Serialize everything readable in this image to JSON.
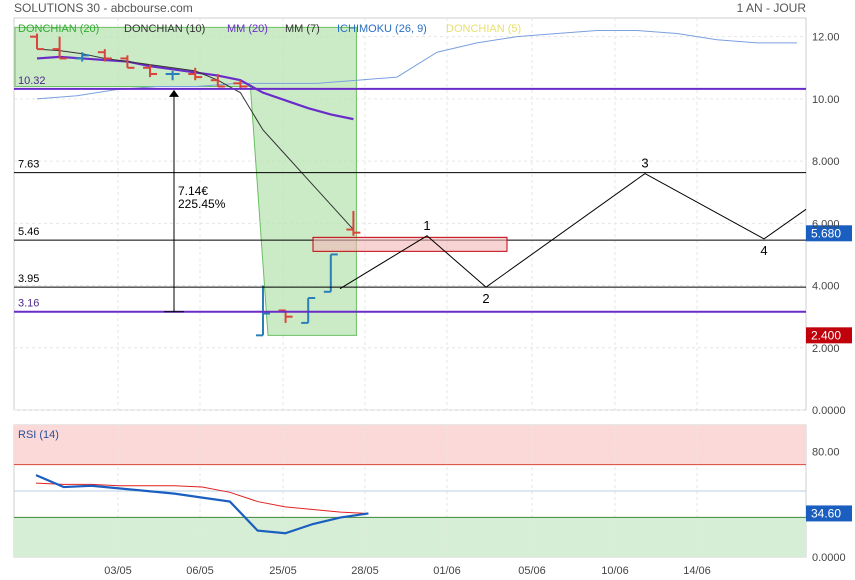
{
  "header": {
    "title": "SOLUTIONS 30 - abcbourse.com",
    "period": "1 AN - JOUR"
  },
  "legend": [
    {
      "label": "DONCHIAN (20)",
      "color": "#33aa33"
    },
    {
      "label": "DONCHIAN (10)",
      "color": "#333333"
    },
    {
      "label": "MM (20)",
      "color": "#6a2cc9"
    },
    {
      "label": "MM (7)",
      "color": "#333333"
    },
    {
      "label": "ICHIMOKU (26, 9)",
      "color": "#2a6fc4"
    },
    {
      "label": "DONCHIAN (5)",
      "color": "#e8e070"
    }
  ],
  "colors": {
    "up_candle": "#2a7fb8",
    "down_candle": "#d9453b",
    "donchian_fill": "#b9e4b4",
    "mm20": "#6a2cc9",
    "rsi_line": "#1a5fc0",
    "rsi_signal": "#e02020",
    "price_badge": "#1a5fc0",
    "low_badge": "#c0000b",
    "rsi_badge": "#1a5fc0"
  },
  "chart_data": [
    {
      "type": "line",
      "title": "SOLUTIONS 30",
      "ylim": [
        0,
        12.6
      ],
      "y_ticks": [
        "12.00",
        "10.00",
        "8.000",
        "6.000",
        "4.000",
        "2.000",
        "0.0000"
      ],
      "y_tick_values": [
        12,
        10,
        8,
        6,
        4,
        2,
        0
      ],
      "x_ticks": [
        "03/05",
        "06/05",
        "25/05",
        "28/05",
        "01/06",
        "05/06",
        "10/06",
        "14/06"
      ],
      "candles": [
        {
          "open": 12.0,
          "high": 12.1,
          "low": 11.6,
          "close": 11.6
        },
        {
          "open": 11.6,
          "high": 12.0,
          "low": 11.3,
          "close": 11.3
        },
        {
          "open": 11.3,
          "high": 11.5,
          "low": 11.2,
          "close": 11.4
        },
        {
          "open": 11.5,
          "high": 11.6,
          "low": 11.2,
          "close": 11.3
        },
        {
          "open": 11.3,
          "high": 11.4,
          "low": 11.0,
          "close": 11.0
        },
        {
          "open": 11.0,
          "high": 11.1,
          "low": 10.7,
          "close": 10.8
        },
        {
          "open": 10.8,
          "high": 10.9,
          "low": 10.6,
          "close": 10.8
        },
        {
          "open": 10.8,
          "high": 11.0,
          "low": 10.6,
          "close": 10.7
        },
        {
          "open": 10.6,
          "high": 10.8,
          "low": 10.4,
          "close": 10.4
        },
        {
          "open": 10.5,
          "high": 10.6,
          "low": 10.3,
          "close": 10.4
        },
        {
          "open": 2.4,
          "high": 4.0,
          "low": 2.4,
          "close": 3.1
        },
        {
          "open": 3.2,
          "high": 3.2,
          "low": 2.8,
          "close": 3.0
        },
        {
          "open": 2.8,
          "high": 3.6,
          "low": 2.8,
          "close": 3.6
        },
        {
          "open": 3.8,
          "high": 5.0,
          "low": 3.8,
          "close": 5.0
        },
        {
          "open": 5.8,
          "high": 6.4,
          "low": 5.6,
          "close": 5.7
        }
      ],
      "series": [
        {
          "name": "DONCHIAN (20)",
          "upper": 12.3,
          "lower_start": 10.4,
          "lower_end": 2.4
        },
        {
          "name": "MM (20)",
          "values": [
            11.3,
            11.35,
            11.3,
            11.25,
            11.2,
            11.05,
            10.95,
            10.85,
            10.75,
            10.6,
            10.2,
            9.95,
            9.7,
            9.5,
            9.35
          ]
        },
        {
          "name": "MM (7)",
          "values": [
            11.6,
            11.55,
            11.45,
            11.3,
            11.2,
            11.1,
            11.0,
            10.9,
            10.6,
            10.2,
            9.0,
            8.2,
            7.4,
            6.6,
            5.8
          ]
        },
        {
          "name": "ICHIMOKU (26, 9)",
          "values": [
            10.0,
            10.1,
            10.3,
            10.4,
            10.4,
            10.5,
            10.5,
            10.5,
            10.6,
            10.7,
            11.5,
            11.8,
            12.0,
            12.1,
            12.2,
            12.2,
            12.1,
            11.9,
            11.8,
            11.8
          ]
        }
      ],
      "levels": [
        {
          "label": "10.32",
          "value": 10.32,
          "color": "#6a2cc9"
        },
        {
          "label": "7.63",
          "value": 7.63,
          "color": "#000000"
        },
        {
          "label": "5.46",
          "value": 5.46,
          "color": "#000000"
        },
        {
          "label": "3.95",
          "value": 3.95,
          "color": "#000000"
        },
        {
          "label": "3.16",
          "value": 3.16,
          "color": "#6a2cc9"
        }
      ],
      "annotations": {
        "measure_value": "7.14€",
        "measure_pct": "225.45%",
        "measure_from": 10.32,
        "measure_to": 3.16,
        "wave_points": [
          {
            "label": "",
            "value": 3.9
          },
          {
            "label": "1",
            "value": 5.6
          },
          {
            "label": "2",
            "value": 3.95
          },
          {
            "label": "3",
            "value": 7.6
          },
          {
            "label": "4",
            "value": 5.5
          },
          {
            "label": "",
            "value": 6.45
          }
        ],
        "zone": {
          "low": 5.1,
          "high": 5.55
        }
      },
      "price_badges": [
        {
          "label": "5.680",
          "value": 5.68
        },
        {
          "label": "2.400",
          "value": 2.4
        }
      ]
    },
    {
      "type": "line",
      "title": "RSI (14)",
      "ylim": [
        0,
        100
      ],
      "y_ticks": [
        "80.00",
        "0.0000"
      ],
      "y_tick_values": [
        80,
        0
      ],
      "overbought": 70,
      "oversold": 30,
      "midline": 50,
      "series": [
        {
          "name": "RSI (14)",
          "values": [
            62,
            53,
            54,
            52,
            50,
            48,
            45,
            42,
            20,
            18,
            25,
            30,
            33
          ]
        },
        {
          "name": "Signal",
          "values": [
            56,
            55,
            55,
            54,
            54,
            54,
            53,
            49,
            42,
            38,
            36,
            34,
            33
          ]
        }
      ],
      "badge": "34.60"
    }
  ]
}
